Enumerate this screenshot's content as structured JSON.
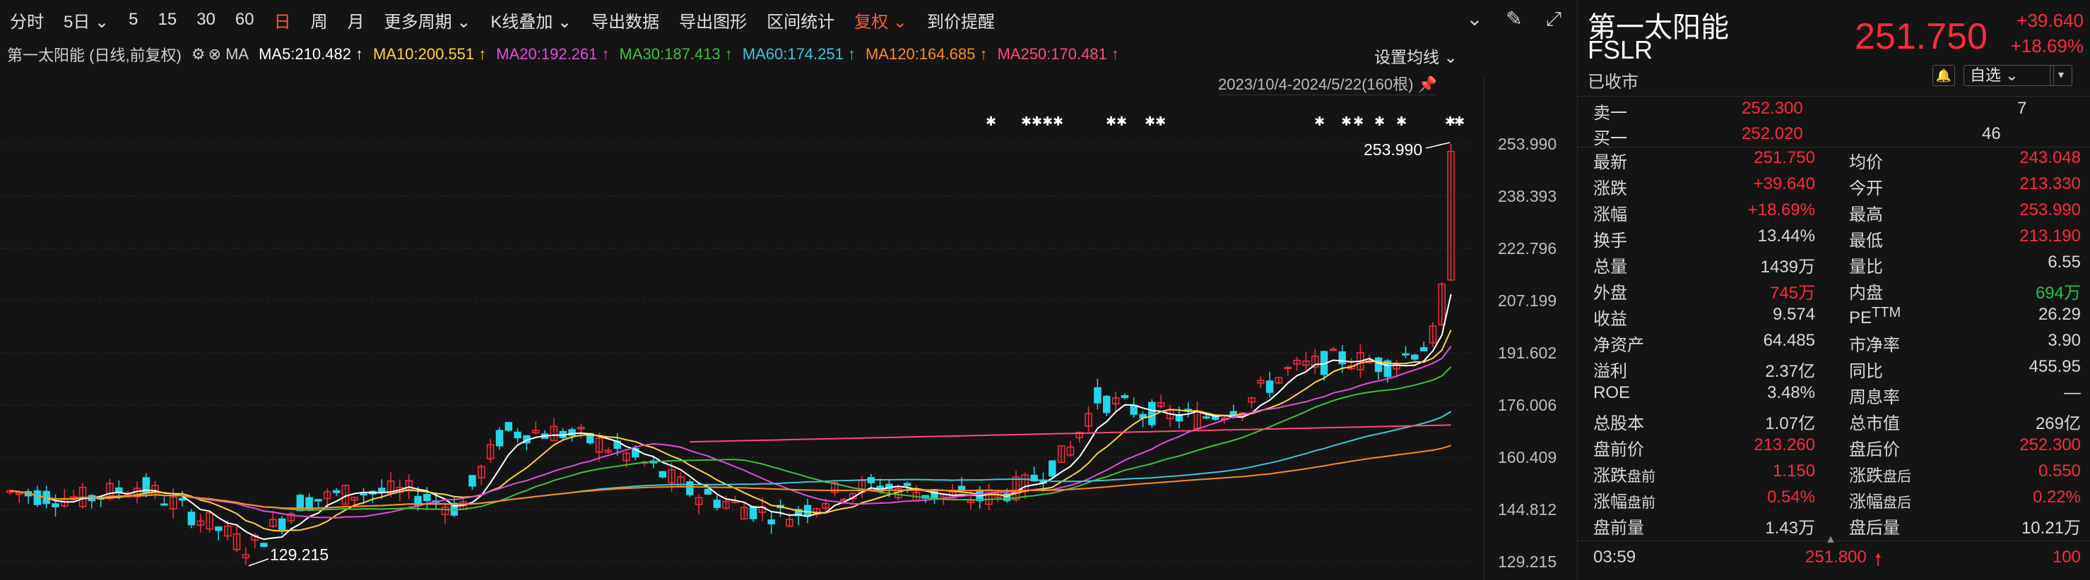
{
  "toolbar": {
    "items": [
      {
        "label": "分时"
      },
      {
        "label": "5日 ⌄"
      },
      {
        "label": "5"
      },
      {
        "label": "15"
      },
      {
        "label": "30"
      },
      {
        "label": "60"
      },
      {
        "label": "日",
        "active": true
      },
      {
        "label": "周"
      },
      {
        "label": "月"
      },
      {
        "label": "更多周期 ⌄"
      },
      {
        "label": "K线叠加 ⌄"
      },
      {
        "label": "导出数据"
      },
      {
        "label": "导出图形"
      },
      {
        "label": "区间统计"
      },
      {
        "label": "复权 ⌄",
        "active": true
      },
      {
        "label": "到价提醒"
      }
    ],
    "icons": [
      "chevron-down-circle-icon",
      "pen-icon",
      "expand-icon"
    ]
  },
  "ma_row": {
    "title": "第一太阳能 (日线,前复权)",
    "ma_label": "MA",
    "items": [
      {
        "text": "MA5:210.482 ↑",
        "color": "#ffffff"
      },
      {
        "text": "MA10:200.551 ↑",
        "color": "#ffd33b"
      },
      {
        "text": "MA20:192.261 ↑",
        "color": "#e04de0"
      },
      {
        "text": "MA30:187.413 ↑",
        "color": "#40c040"
      },
      {
        "text": "MA60:174.251 ↑",
        "color": "#3fc6d6"
      },
      {
        "text": "MA120:164.685 ↑",
        "color": "#ff8a1c"
      },
      {
        "text": "MA250:170.481 ↑",
        "color": "#ff4a7a"
      }
    ],
    "setting": "设置均线 ⌄",
    "range": "2023/10/4-2024/5/22(160根)"
  },
  "chart_data": {
    "type": "candlestick",
    "y_ticks": [
      "253.990",
      "238.393",
      "222.796",
      "207.199",
      "191.602",
      "176.006",
      "160.409",
      "144.812",
      "129.215"
    ],
    "ylim": [
      129.215,
      253.99
    ],
    "max_label": "253.990",
    "min_label": "129.215",
    "series_colors": {
      "up": "#ff2a3b",
      "down": "#22d6ea"
    }
  },
  "quote": {
    "name": "第一太阳能",
    "code": "FSLR",
    "status": "已收市",
    "price": "251.750",
    "change": "+39.640",
    "change_pct": "+18.69%",
    "watch_label": "自选 ⌄",
    "orderbook": [
      {
        "label": "卖一",
        "price": "252.300",
        "vol": "7"
      },
      {
        "label": "买一",
        "price": "252.020",
        "vol": "46"
      }
    ],
    "fields": [
      {
        "k1": "最新",
        "v1": "251.750",
        "c1": "red",
        "k2": "均价",
        "v2": "243.048",
        "c2": "red"
      },
      {
        "k1": "涨跌",
        "v1": "+39.640",
        "c1": "red",
        "k2": "今开",
        "v2": "213.330",
        "c2": "red"
      },
      {
        "k1": "涨幅",
        "v1": "+18.69%",
        "c1": "red",
        "k2": "最高",
        "v2": "253.990",
        "c2": "red"
      },
      {
        "k1": "换手",
        "v1": "13.44%",
        "c1": "",
        "k2": "最低",
        "v2": "213.190",
        "c2": "red"
      },
      {
        "k1": "总量",
        "v1": "1439万",
        "c1": "",
        "k2": "量比",
        "v2": "6.55",
        "c2": ""
      },
      {
        "k1": "外盘",
        "v1": "745万",
        "c1": "red",
        "k2": "内盘",
        "v2": "694万",
        "c2": "green"
      },
      {
        "k1": "收益",
        "v1": "9.574",
        "c1": "",
        "k2": "PE",
        "k2sup": "TTM",
        "v2": "26.29",
        "c2": ""
      },
      {
        "k1": "净资产",
        "v1": "64.485",
        "c1": "",
        "k2": "市净率",
        "v2": "3.90",
        "c2": ""
      },
      {
        "k1": "溢利",
        "v1": "2.37亿",
        "c1": "",
        "k2": "同比",
        "v2": "455.95",
        "c2": ""
      },
      {
        "k1": "ROE",
        "v1": "3.48%",
        "c1": "",
        "k2": "周息率",
        "v2": "—",
        "c2": ""
      },
      {
        "k1": "总股本",
        "v1": "1.07亿",
        "c1": "",
        "k2": "总市值",
        "v2": "269亿",
        "c2": ""
      },
      {
        "k1": "盘前价",
        "v1": "213.260",
        "c1": "red",
        "k2": "盘后价",
        "v2": "252.300",
        "c2": "red"
      },
      {
        "k1": "涨跌",
        "k1s": "盘前",
        "v1": "1.150",
        "c1": "red",
        "k2": "涨跌",
        "k2s": "盘后",
        "v2": "0.550",
        "c2": "red"
      },
      {
        "k1": "涨幅",
        "k1s": "盘前",
        "v1": "0.54%",
        "c1": "red",
        "k2": "涨幅",
        "k2s": "盘后",
        "v2": "0.22%",
        "c2": "red"
      },
      {
        "k1": "盘前量",
        "v1": "1.43万",
        "c1": "",
        "k2": "盘后量",
        "v2": "10.21万",
        "c2": ""
      }
    ],
    "footer": {
      "time": "03:59",
      "price": "251.800",
      "vol": "100"
    }
  }
}
